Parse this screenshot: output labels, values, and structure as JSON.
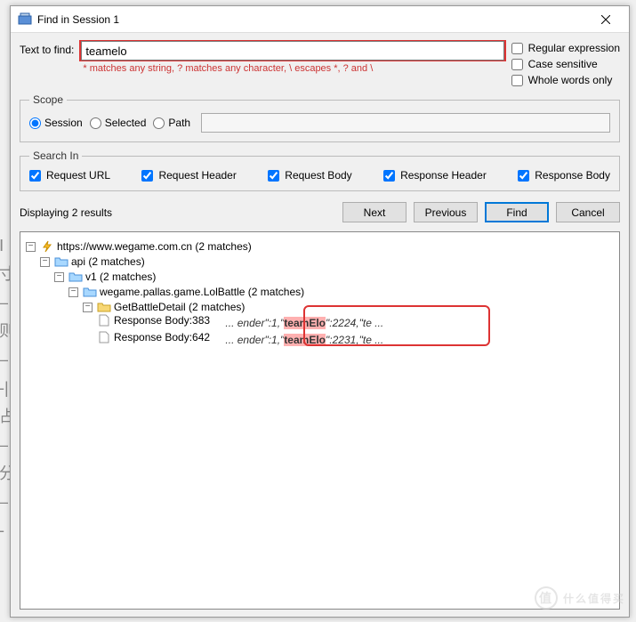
{
  "window": {
    "title": "Find in Session 1"
  },
  "find": {
    "label": "Text to find:",
    "value": "teamelo",
    "hint": "* matches any string, ? matches any character, \\ escapes *, ? and \\"
  },
  "options": {
    "regex": "Regular expression",
    "case": "Case sensitive",
    "whole": "Whole words only"
  },
  "scope": {
    "legend": "Scope",
    "session": "Session",
    "selected": "Selected",
    "path": "Path"
  },
  "searchIn": {
    "legend": "Search In",
    "reqUrl": "Request URL",
    "reqHeader": "Request Header",
    "reqBody": "Request Body",
    "resHeader": "Response Header",
    "resBody": "Response Body"
  },
  "resultsText": "Displaying 2 results",
  "buttons": {
    "next": "Next",
    "prev": "Previous",
    "find": "Find",
    "cancel": "Cancel"
  },
  "tree": {
    "root": "https://www.wegame.com.cn (2 matches)",
    "api": "api (2 matches)",
    "v1": "v1 (2 matches)",
    "battle": "wegame.pallas.game.LolBattle (2 matches)",
    "detail": "GetBattleDetail (2 matches)",
    "r1": {
      "label": "Response Body:383",
      "pre": "... ender\":1,\"",
      "hl": "teamElo",
      "post": "\":2224,\"te ..."
    },
    "r2": {
      "label": "Response Body:642",
      "pre": "... ender\":1,\"",
      "hl": "teamElo",
      "post": "\":2231,\"te ..."
    }
  },
  "watermark": "什么值得买"
}
